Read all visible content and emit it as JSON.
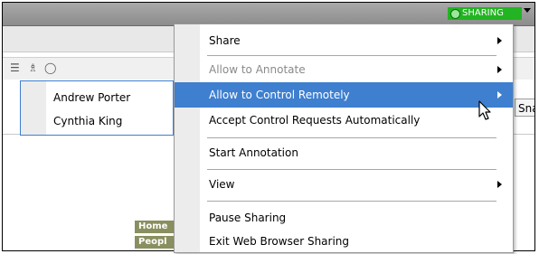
{
  "titlebar": {
    "sharing_badge": "SHARING"
  },
  "side_panel": {
    "snag_label": "Snag"
  },
  "nav": {
    "items": [
      "Home",
      "Peopl"
    ]
  },
  "participants_submenu": {
    "items": [
      {
        "label": "Andrew Porter"
      },
      {
        "label": "Cynthia King"
      }
    ]
  },
  "context_menu": {
    "items": [
      {
        "label": "Share",
        "submenu": true,
        "enabled": true,
        "highlighted": false
      },
      {
        "label": "Allow to Annotate",
        "submenu": true,
        "enabled": false,
        "highlighted": false
      },
      {
        "label": "Allow to Control Remotely",
        "submenu": true,
        "enabled": true,
        "highlighted": true
      },
      {
        "label": "Accept Control Requests Automatically",
        "submenu": false,
        "enabled": true,
        "highlighted": false
      },
      {
        "label": "Start Annotation",
        "submenu": false,
        "enabled": true,
        "highlighted": false
      },
      {
        "label": "View",
        "submenu": true,
        "enabled": true,
        "highlighted": false
      },
      {
        "label": "Pause Sharing",
        "submenu": false,
        "enabled": true,
        "highlighted": false
      },
      {
        "label": "Exit Web Browser Sharing",
        "submenu": false,
        "enabled": true,
        "highlighted": false
      }
    ]
  },
  "colors": {
    "highlight": "#3e7fcf",
    "sharing_badge": "#22b422",
    "disabled_text": "#8a8a8a"
  },
  "icons": [
    "mouse-pointer-icon",
    "people-icon",
    "chat-icon",
    "submenu-arrow-icon",
    "dropdown-arrow-icon"
  ]
}
